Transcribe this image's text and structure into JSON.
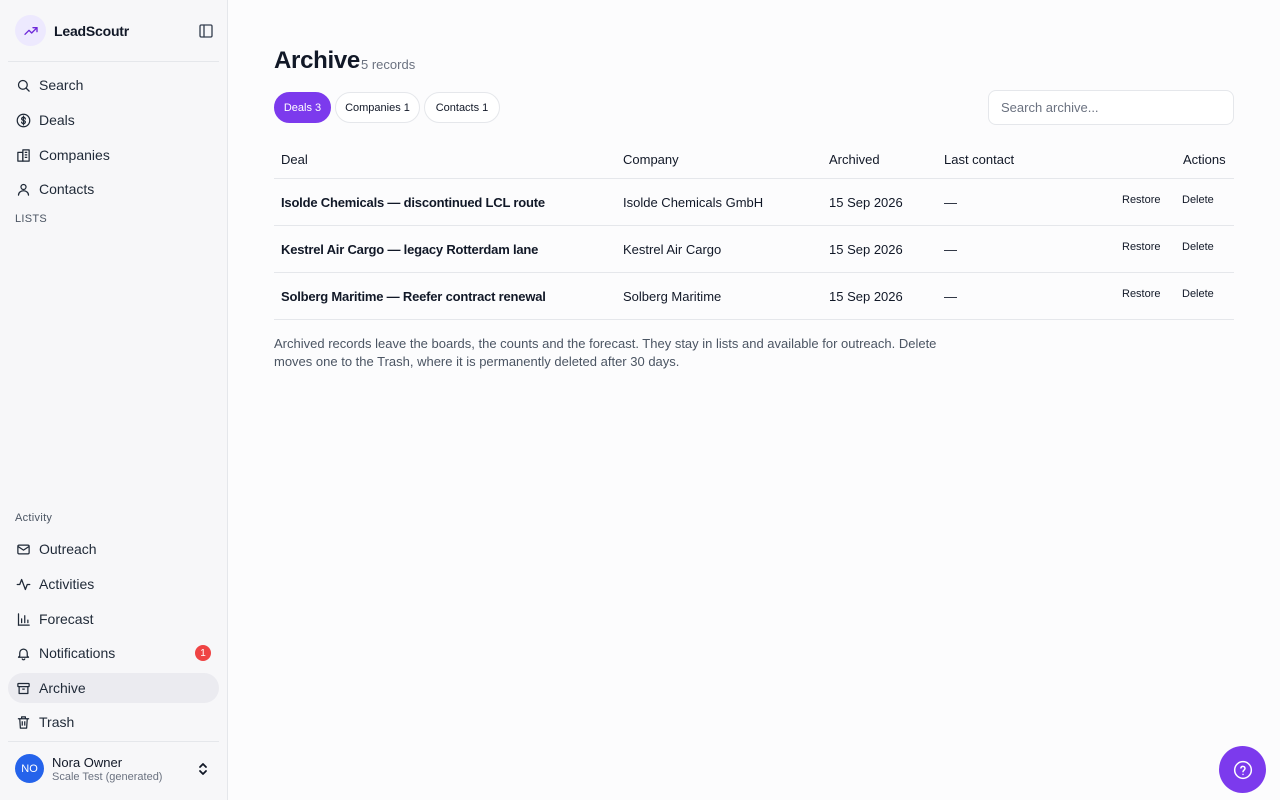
{
  "brand": {
    "name": "LeadScoutr",
    "logo_icon": "trending-up-icon"
  },
  "nav": {
    "primary": [
      {
        "label": "Search",
        "icon": "search-icon"
      },
      {
        "label": "Deals",
        "icon": "dollar-icon"
      },
      {
        "label": "Companies",
        "icon": "building-icon"
      },
      {
        "label": "Contacts",
        "icon": "user-icon"
      }
    ],
    "lists_label": "LISTS",
    "activity_label": "Activity",
    "secondary": [
      {
        "label": "Outreach",
        "icon": "mail-icon"
      },
      {
        "label": "Activities",
        "icon": "activity-icon"
      },
      {
        "label": "Forecast",
        "icon": "bar-chart-icon"
      },
      {
        "label": "Notifications",
        "icon": "bell-icon",
        "badge": "1"
      },
      {
        "label": "Archive",
        "icon": "archive-icon",
        "active": true
      },
      {
        "label": "Trash",
        "icon": "trash-icon"
      }
    ]
  },
  "user": {
    "initials": "NO",
    "name": "Nora Owner",
    "org": "Scale Test (generated)"
  },
  "page": {
    "title": "Archive",
    "count": "5 records"
  },
  "tabs": [
    {
      "label": "Deals 3",
      "active": true
    },
    {
      "label": "Companies 1",
      "active": false
    },
    {
      "label": "Contacts 1",
      "active": false
    }
  ],
  "search": {
    "placeholder": "Search archive...",
    "value": ""
  },
  "table": {
    "headers": {
      "deal": "Deal",
      "company": "Company",
      "archived": "Archived",
      "last_contact": "Last contact",
      "actions": "Actions"
    },
    "rows": [
      {
        "deal": "Isolde Chemicals — discontinued LCL route",
        "company": "Isolde Chemicals GmbH",
        "archived": "15 Sep 2026",
        "last_contact": "—"
      },
      {
        "deal": "Kestrel Air Cargo — legacy Rotterdam lane",
        "company": "Kestrel Air Cargo",
        "archived": "15 Sep 2026",
        "last_contact": "—"
      },
      {
        "deal": "Solberg Maritime — Reefer contract renewal",
        "company": "Solberg Maritime",
        "archived": "15 Sep 2026",
        "last_contact": "—"
      }
    ],
    "actions": {
      "restore": "Restore",
      "delete": "Delete"
    }
  },
  "note": "Archived records leave the boards, the counts and the forecast. They stay in lists and available for outreach. Delete moves one to the Trash, where it is permanently deleted after 30 days.",
  "colors": {
    "accent": "#7c3aed",
    "badge": "#ef4444",
    "avatar": "#2563eb"
  }
}
